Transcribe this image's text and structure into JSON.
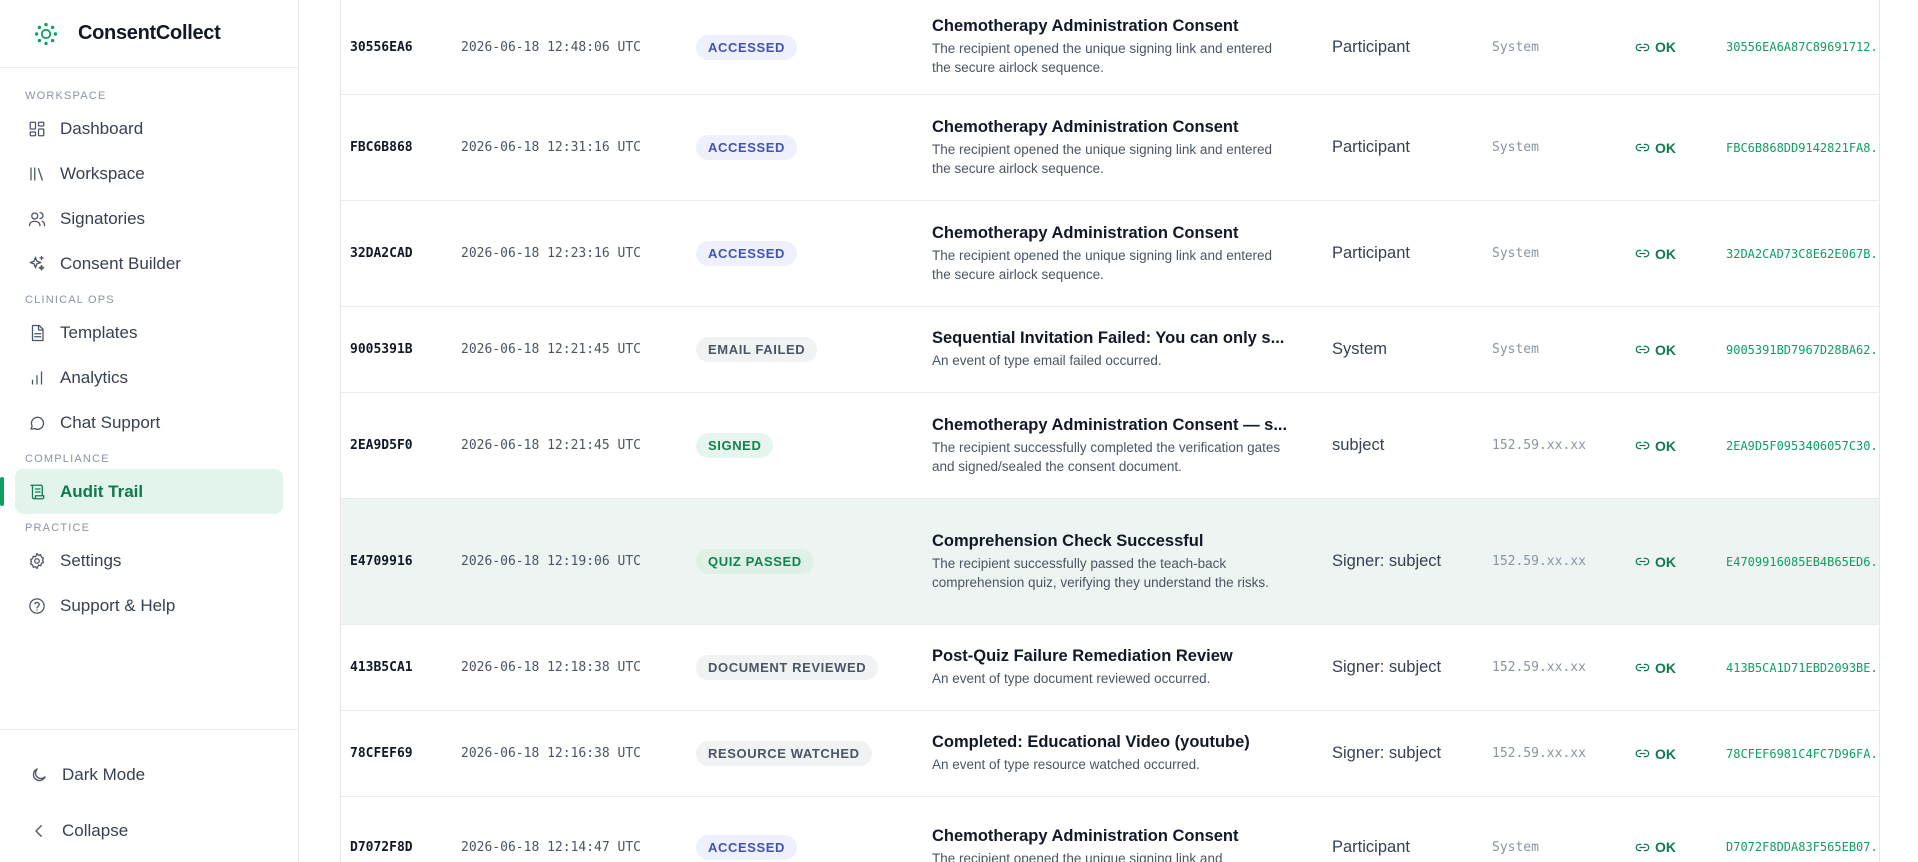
{
  "brand": {
    "name": "ConsentCollect",
    "color": "#0e9f62"
  },
  "sidebar": {
    "sections": [
      {
        "label": "WORKSPACE",
        "items": [
          {
            "label": "Dashboard",
            "icon": "dashboard-grid-icon"
          },
          {
            "label": "Workspace",
            "icon": "library-icon"
          },
          {
            "label": "Signatories",
            "icon": "users-icon"
          },
          {
            "label": "Consent Builder",
            "icon": "sparkles-icon"
          }
        ]
      },
      {
        "label": "CLINICAL OPS",
        "items": [
          {
            "label": "Templates",
            "icon": "document-icon"
          },
          {
            "label": "Analytics",
            "icon": "bar-chart-icon"
          },
          {
            "label": "Chat Support",
            "icon": "chat-bubble-icon"
          }
        ]
      },
      {
        "label": "COMPLIANCE",
        "items": [
          {
            "label": "Audit Trail",
            "icon": "scroll-icon",
            "active": true
          }
        ]
      },
      {
        "label": "PRACTICE",
        "items": [
          {
            "label": "Settings",
            "icon": "gear-icon"
          },
          {
            "label": "Support & Help",
            "icon": "help-circle-icon"
          }
        ]
      }
    ],
    "footer": {
      "dark_mode": "Dark Mode",
      "collapse": "Collapse"
    }
  },
  "audit": {
    "status_text": "OK",
    "rows": [
      {
        "id": "30556EA6",
        "time": "2026-06-18 12:48:06 UTC",
        "badge": "ACCESSED",
        "type": "accessed",
        "title": "Chemotherapy Administration Consent",
        "sub": "The recipient opened the unique signing link and entered the secure airlock sequence.",
        "actor": "Participant",
        "ip": "System",
        "hash": "30556EA6A87C89691712..."
      },
      {
        "id": "FBC6B868",
        "time": "2026-06-18 12:31:16 UTC",
        "badge": "ACCESSED",
        "type": "accessed",
        "title": "Chemotherapy Administration Consent",
        "sub": "The recipient opened the unique signing link and entered the secure airlock sequence.",
        "actor": "Participant",
        "ip": "System",
        "hash": "FBC6B868DD9142821FA8..."
      },
      {
        "id": "32DA2CAD",
        "time": "2026-06-18 12:23:16 UTC",
        "badge": "ACCESSED",
        "type": "accessed",
        "title": "Chemotherapy Administration Consent",
        "sub": "The recipient opened the unique signing link and entered the secure airlock sequence.",
        "actor": "Participant",
        "ip": "System",
        "hash": "32DA2CAD73C8E62E067B..."
      },
      {
        "id": "9005391B",
        "time": "2026-06-18 12:21:45 UTC",
        "badge": "EMAIL FAILED",
        "type": "failed",
        "title": "Sequential Invitation Failed: You can only s...",
        "sub": "An event of type email failed occurred.",
        "actor": "System",
        "ip": "System",
        "hash": "9005391BD7967D28BA62..."
      },
      {
        "id": "2EA9D5F0",
        "time": "2026-06-18 12:21:45 UTC",
        "badge": "SIGNED",
        "type": "signed",
        "title": "Chemotherapy Administration Consent — s...",
        "sub": "The recipient successfully completed the verification gates and signed/sealed the consent document.",
        "actor": "subject",
        "ip": "152.59.xx.xx",
        "hash": "2EA9D5F0953406057C30..."
      },
      {
        "id": "E4709916",
        "time": "2026-06-18 12:19:06 UTC",
        "badge": "QUIZ PASSED",
        "type": "quiz",
        "title": "Comprehension Check Successful",
        "sub": "The recipient successfully passed the teach-back comprehension quiz, verifying they understand the risks.",
        "actor": "Signer: subject",
        "ip": "152.59.xx.xx",
        "hash": "E4709916085EB4B65ED6...",
        "highlight": true
      },
      {
        "id": "413B5CA1",
        "time": "2026-06-18 12:18:38 UTC",
        "badge": "DOCUMENT REVIEWED",
        "type": "reviewed",
        "title": "Post-Quiz Failure Remediation Review",
        "sub": "An event of type document reviewed occurred.",
        "actor": "Signer: subject",
        "ip": "152.59.xx.xx",
        "hash": "413B5CA1D71EBD2093BE..."
      },
      {
        "id": "78CFEF69",
        "time": "2026-06-18 12:16:38 UTC",
        "badge": "RESOURCE WATCHED",
        "type": "watched",
        "title": "Completed: Educational Video (youtube)",
        "sub": "An event of type resource watched occurred.",
        "actor": "Signer: subject",
        "ip": "152.59.xx.xx",
        "hash": "78CFEF6981C4FC7D96FA..."
      },
      {
        "id": "D7072F8D",
        "time": "2026-06-18 12:14:47 UTC",
        "badge": "ACCESSED",
        "type": "accessed",
        "title": "Chemotherapy Administration Consent",
        "sub": "The recipient opened the unique signing link and",
        "actor": "Participant",
        "ip": "System",
        "hash": "D7072F8DDA83F565EB07..."
      }
    ]
  }
}
